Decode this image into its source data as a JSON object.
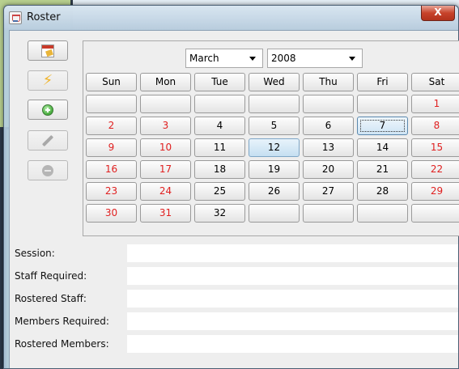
{
  "window": {
    "title": "Roster",
    "close_label": "X"
  },
  "toolbar": {
    "buttons": [
      {
        "icon": "calendar-icon",
        "enabled": true
      },
      {
        "icon": "lightning-icon",
        "enabled": false
      },
      {
        "icon": "add-icon",
        "enabled": true
      },
      {
        "icon": "edit-icon",
        "enabled": false
      },
      {
        "icon": "remove-icon",
        "enabled": false
      }
    ]
  },
  "calendar": {
    "month": "March",
    "year": "2008",
    "weekdays": [
      "Sun",
      "Mon",
      "Tue",
      "Wed",
      "Thu",
      "Fri",
      "Sat"
    ],
    "weeks": [
      [
        "",
        "",
        "",
        "",
        "",
        "",
        "1"
      ],
      [
        "2",
        "3",
        "4",
        "5",
        "6",
        "7",
        "8"
      ],
      [
        "9",
        "10",
        "11",
        "12",
        "13",
        "14",
        "15"
      ],
      [
        "16",
        "17",
        "18",
        "19",
        "20",
        "21",
        "22"
      ],
      [
        "23",
        "24",
        "25",
        "26",
        "27",
        "28",
        "29"
      ],
      [
        "30",
        "31",
        "32",
        "",
        "",
        "",
        ""
      ]
    ],
    "red_days": [
      "1",
      "2",
      "3",
      "8",
      "9",
      "10",
      "15",
      "16",
      "17",
      "22",
      "23",
      "24",
      "29",
      "30",
      "31"
    ],
    "today": "12",
    "selected": "7",
    "colors": {
      "weekend": "#e02020",
      "today": "#c5dff1"
    }
  },
  "info": {
    "session_label": "Session:",
    "session_value": "",
    "staff_required_label": "Staff Required:",
    "staff_required_value": "",
    "rostered_staff_label": "Rostered Staff:",
    "rostered_staff_value": "",
    "members_required_label": "Members Required:",
    "members_required_value": "",
    "rostered_members_label": "Rostered Members:",
    "rostered_members_value": ""
  }
}
